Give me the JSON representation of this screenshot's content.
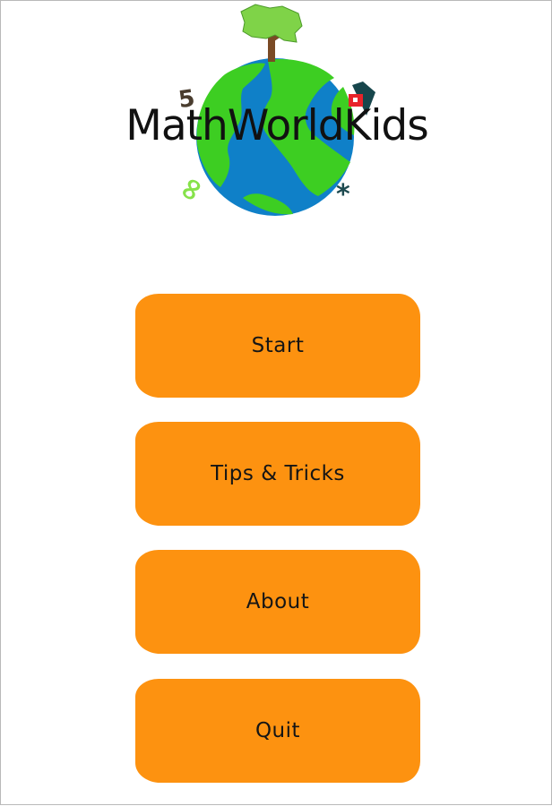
{
  "app": {
    "title": "MathWorldKids"
  },
  "menu": {
    "items": [
      {
        "id": "start",
        "label": "Start"
      },
      {
        "id": "tips",
        "label": "Tips & Tricks"
      },
      {
        "id": "about",
        "label": "About"
      },
      {
        "id": "quit",
        "label": "Quit"
      }
    ]
  },
  "logo": {
    "decorations": {
      "digit_five": "5",
      "infinity": "∞",
      "asterisk": "*"
    }
  },
  "colors": {
    "button": "#fd9210",
    "ocean": "#0f80c8",
    "land": "#3dce22",
    "tree_leaves": "#7fd348",
    "trunk": "#7a4a25",
    "house_roof": "#17464c",
    "house_wall": "#e8232a",
    "infinity": "#86e24a",
    "five": "#4a3d2f",
    "asterisk": "#1d4a50"
  }
}
